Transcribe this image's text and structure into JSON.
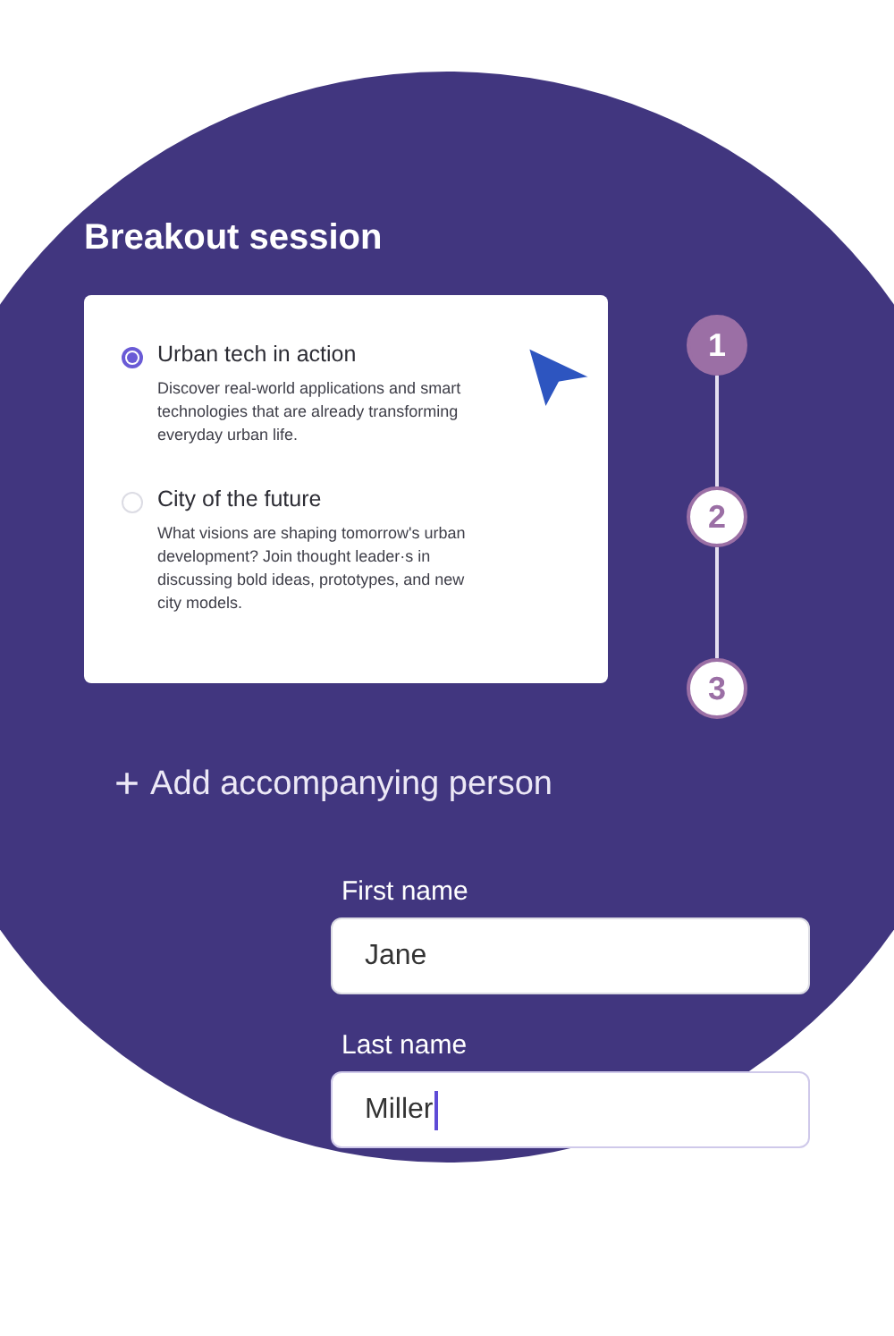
{
  "title": "Breakout session",
  "options": [
    {
      "title": "Urban tech in action",
      "description": "Discover real-world applications and smart technologies that are already transforming everyday urban life.",
      "selected": true
    },
    {
      "title": "City of the future",
      "description": "What visions are shaping tomorrow's urban development? Join thought leader·s in discussing bold ideas, prototypes, and new city models.",
      "selected": false
    }
  ],
  "steps": [
    {
      "label": "1",
      "selected": true
    },
    {
      "label": "2",
      "selected": false
    },
    {
      "label": "3",
      "selected": false
    }
  ],
  "add_button": {
    "icon": "+",
    "label": "Add accompanying person"
  },
  "fields": [
    {
      "label": "First name",
      "value": "Jane",
      "focused": false
    },
    {
      "label": "Last name",
      "value": "Miller",
      "focused": true
    }
  ]
}
